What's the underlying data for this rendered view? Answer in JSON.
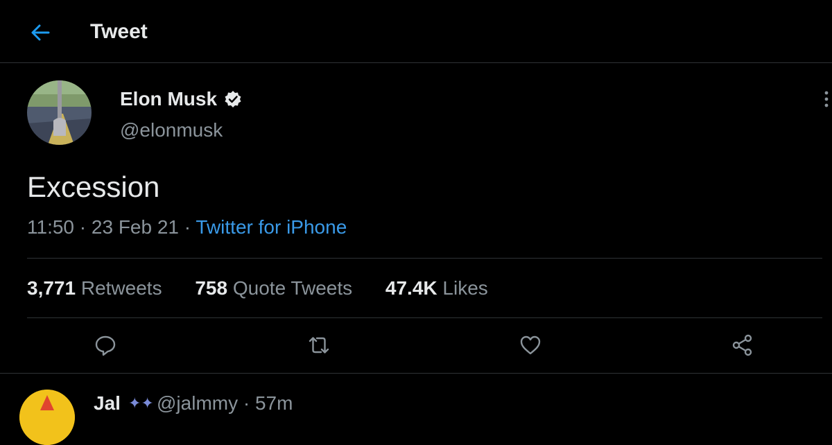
{
  "header": {
    "back_icon": "arrow-left-icon",
    "title": "Tweet"
  },
  "tweet": {
    "author": {
      "display_name": "Elon Musk",
      "handle": "@elonmusk",
      "verified": true
    },
    "text": "Excession",
    "time": "11:50",
    "date": "23 Feb 21",
    "separator": "·",
    "source": "Twitter for iPhone",
    "stats": [
      {
        "count": "3,771",
        "label": "Retweets"
      },
      {
        "count": "758",
        "label": "Quote Tweets"
      },
      {
        "count": "47.4K",
        "label": "Likes"
      }
    ],
    "actions": [
      "reply-icon",
      "retweet-icon",
      "like-icon",
      "share-icon"
    ]
  },
  "reply_preview": {
    "display_name": "Jal",
    "handle": "@jalmmy",
    "time": "57m"
  },
  "colors": {
    "background": "#000000",
    "text": "#e7e9ea",
    "secondary_text": "#8b949b",
    "accent": "#1d9bf0",
    "divider": "#2f3336"
  }
}
